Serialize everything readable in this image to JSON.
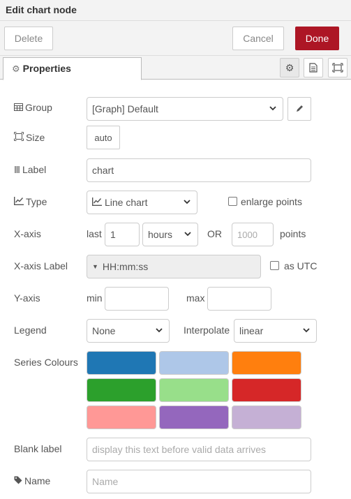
{
  "title": "Edit chart node",
  "toolbar": {
    "delete_label": "Delete",
    "cancel_label": "Cancel",
    "done_label": "Done"
  },
  "tabs": {
    "properties_label": "Properties"
  },
  "icons": {
    "gear": "gear-icon",
    "document": "document-icon",
    "frame": "frame-icon",
    "table": "table-icon",
    "size": "size-icon",
    "text-cursor": "text-cursor-icon",
    "chart": "line-chart-icon",
    "tag": "tag-icon",
    "pencil": "pencil-icon"
  },
  "form": {
    "group_label": "Group",
    "group_value": "[Graph] Default",
    "size_label": "Size",
    "size_value": "auto",
    "label_label": "Label",
    "label_value": "chart",
    "type_label": "Type",
    "type_value": "Line chart",
    "enlarge_points_label": "enlarge points",
    "xaxis_label": "X-axis",
    "xaxis_last": "last",
    "xaxis_last_value": "1",
    "xaxis_unit": "hours",
    "xaxis_or": "OR",
    "xaxis_points_placeholder": "1000",
    "xaxis_points_label": "points",
    "xaxis_label_label": "X-axis Label",
    "xaxis_label_value": "HH:mm:ss",
    "as_utc_label": "as UTC",
    "yaxis_label": "Y-axis",
    "yaxis_min": "min",
    "yaxis_max": "max",
    "legend_label": "Legend",
    "legend_value": "None",
    "interpolate_label": "Interpolate",
    "interpolate_value": "linear",
    "series_colours_label": "Series Colours",
    "series_colours": [
      "#1f77b4",
      "#aec7e8",
      "#ff7f0e",
      "#2ca02c",
      "#98df8a",
      "#d62728",
      "#ff9896",
      "#9467bd",
      "#c5b0d5"
    ],
    "blank_label_label": "Blank label",
    "blank_label_placeholder": "display this text before valid data arrives",
    "name_label": "Name",
    "name_placeholder": "Name"
  },
  "colors": {
    "accent": "#ad1625"
  }
}
